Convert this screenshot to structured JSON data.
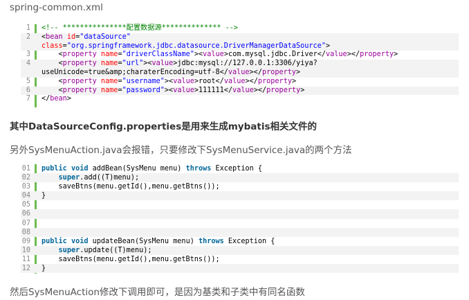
{
  "heading_text": "spring-common.xml",
  "bold_text": "其中DataSourceConfig.properties是用来生成mybatis相关文件的",
  "desc_text": "另外SysMenuAction.java会报错，只要修改下SysMenuService.java的两个方法",
  "last_text": "然后SysMenuAction修改下调用即可，是因为基类和子类中有同名函数",
  "code1": {
    "line_numbers": [
      "1",
      "2",
      "3",
      "4",
      "5",
      "6",
      "7"
    ],
    "lines": [
      "<!-- ***************配置数据源************** -->",
      "<bean id=\"dataSource\"\nclass=\"org.springframework.jdbc.datasource.DriverManagerDataSource\">",
      "    <property name=\"driverClassName\"><value>com.mysql.jdbc.Driver</value></property>",
      "    <property name=\"url\"><value>jdbc:mysql://127.0.0.1:3306/yiya?\nuseUnicode=true&amp;charaterEncoding=utf-8</value></property>",
      "    <property name=\"username\"><value>root</value></property>",
      "    <property name=\"password\"><value>111111</value></property>",
      "</bean>"
    ]
  },
  "code2": {
    "line_numbers": [
      "01",
      "02",
      "03",
      "04",
      "05",
      "06",
      "07",
      "08",
      "09",
      "10",
      "11",
      "12"
    ],
    "lines": [
      "public void addBean(SysMenu menu) throws Exception {",
      "    super.add((T)menu);",
      "    saveBtns(menu.getId(),menu.getBtns());",
      "}",
      "",
      "",
      "",
      "",
      "public void updateBean(SysMenu menu) throws Exception {",
      "    super.update((T)menu);",
      "    saveBtns(menu.getId(),menu.getBtns());",
      "}"
    ]
  },
  "colors": {
    "gutter_bar": "#6cbb4f",
    "keyword": "#006699",
    "tag": "#990099",
    "attr": "#ff0000",
    "string": "#0000ff",
    "comment": "#008200"
  }
}
